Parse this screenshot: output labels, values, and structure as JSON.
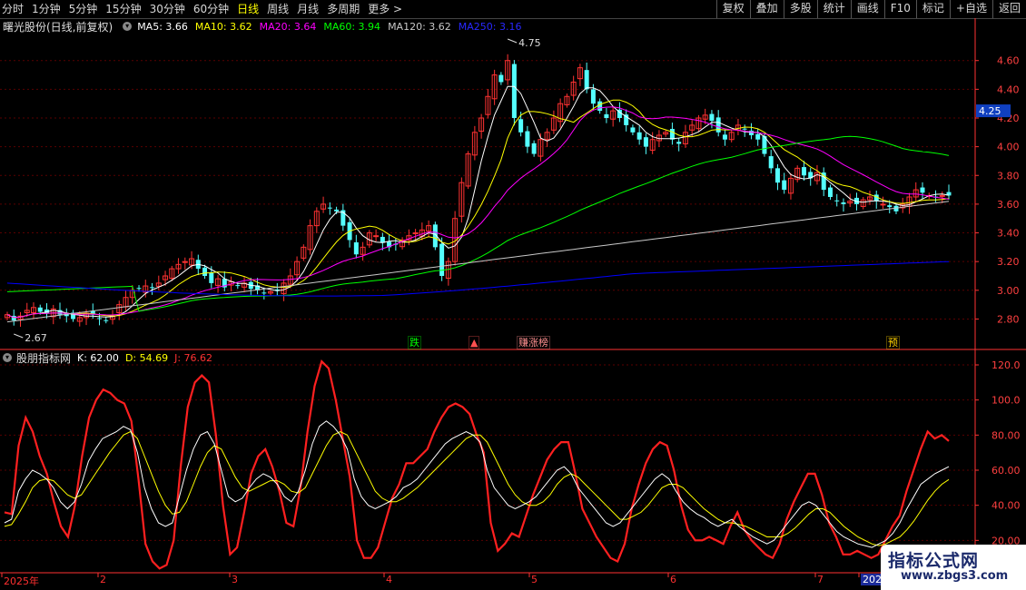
{
  "toolbar": {
    "periods": [
      "分时",
      "1分钟",
      "5分钟",
      "15分钟",
      "30分钟",
      "60分钟",
      "日线",
      "周线",
      "月线",
      "多周期",
      "更多 >"
    ],
    "active_period": "日线",
    "actions": [
      "复权",
      "叠加",
      "多股",
      "统计",
      "画线",
      "F10",
      "标记",
      "+自选",
      "返回"
    ]
  },
  "main_header": {
    "stock": "曙光股份(日线,前复权)",
    "ma5": "MA5: 3.66",
    "ma10": "MA10: 3.62",
    "ma20": "MA20: 3.64",
    "ma60": "MA60: 3.94",
    "ma120": "MA120: 3.62",
    "ma250": "MA250: 3.16"
  },
  "colors": {
    "up": "#ff3232",
    "down": "#54ffff",
    "ma5": "#ffffff",
    "ma10": "#ffff00",
    "ma20": "#ff00ff",
    "ma60": "#00ff00",
    "ma120": "#c8c8c8",
    "ma250": "#0000ff",
    "axis": "#ff3232",
    "grid": "#5a0000"
  },
  "price_axis": {
    "ticks": [
      "4.60",
      "4.40",
      "4.20",
      "4.00",
      "3.80",
      "3.60",
      "3.40",
      "3.20",
      "3.00",
      "2.80"
    ],
    "current": "4.25"
  },
  "annotations": {
    "high": "4.75",
    "low": "2.67"
  },
  "markers": [
    {
      "text": "跌",
      "color": "#00ff00"
    },
    {
      "text": "▲",
      "color": "#ff5050"
    },
    {
      "text": "赚涨榜",
      "color": "#ff9090"
    },
    {
      "text": "预",
      "color": "#ffd000"
    }
  ],
  "indicator_header": {
    "name": "股朋指标网",
    "k": "K: 62.00",
    "d": "D: 54.69",
    "j": "J: 76.62"
  },
  "indicator_axis": {
    "ticks": [
      "120.0",
      "100.0",
      "80.00",
      "60.00",
      "40.00",
      "20.00"
    ]
  },
  "date_axis": {
    "labels": [
      "2025年",
      "2",
      "3",
      "4",
      "5",
      "6",
      "7",
      "2025"
    ]
  },
  "watermark": {
    "line1": "指标公式网",
    "line2": "www.zbgs3.com"
  },
  "chart_data": [
    {
      "type": "candlestick",
      "title": "曙光股份(日线,前复权)",
      "y_range": [
        2.67,
        4.75
      ],
      "last_close": 3.66,
      "series": [
        {
          "name": "MA5",
          "last": 3.66
        },
        {
          "name": "MA10",
          "last": 3.62
        },
        {
          "name": "MA20",
          "last": 3.64
        },
        {
          "name": "MA60",
          "last": 3.94
        },
        {
          "name": "MA120",
          "last": 3.62
        },
        {
          "name": "MA250",
          "last": 3.16
        }
      ],
      "close": [
        2.83,
        2.79,
        2.82,
        2.86,
        2.88,
        2.85,
        2.84,
        2.87,
        2.83,
        2.82,
        2.8,
        2.81,
        2.84,
        2.83,
        2.8,
        2.79,
        2.82,
        2.9,
        2.95,
        3.0,
        3.01,
        3.03,
        3.02,
        3.05,
        3.1,
        3.15,
        3.18,
        3.2,
        3.22,
        3.15,
        3.1,
        3.05,
        3.08,
        3.02,
        3.06,
        3.03,
        3.05,
        3.01,
        3.0,
        2.98,
        2.99,
        3.0,
        3.05,
        3.1,
        3.2,
        3.3,
        3.45,
        3.55,
        3.6,
        3.57,
        3.55,
        3.45,
        3.35,
        3.25,
        3.3,
        3.4,
        3.38,
        3.33,
        3.3,
        3.32,
        3.35,
        3.38,
        3.4,
        3.42,
        3.45,
        3.3,
        3.1,
        3.2,
        3.5,
        3.75,
        3.95,
        4.1,
        4.2,
        4.35,
        4.5,
        4.45,
        4.6,
        4.2,
        4.1,
        4.0,
        3.95,
        4.05,
        4.1,
        4.2,
        4.3,
        4.35,
        4.45,
        4.55,
        4.4,
        4.3,
        4.25,
        4.2,
        4.25,
        4.2,
        4.15,
        4.1,
        4.05,
        4.0,
        4.05,
        4.08,
        4.1,
        4.05,
        4.02,
        4.1,
        4.15,
        4.2,
        4.22,
        4.18,
        4.1,
        4.05,
        4.1,
        4.15,
        4.12,
        4.08,
        4.05,
        3.95,
        3.85,
        3.75,
        3.7,
        3.78,
        3.85,
        3.8,
        3.78,
        3.82,
        3.7,
        3.65,
        3.62,
        3.6,
        3.62,
        3.6,
        3.63,
        3.65,
        3.62,
        3.6,
        3.58,
        3.55,
        3.6,
        3.65,
        3.7,
        3.68,
        3.66,
        3.65,
        3.66,
        3.66
      ],
      "k_end": 62.0,
      "d_end": 54.69,
      "j_end": 76.62
    },
    {
      "type": "line",
      "title": "股朋指标网",
      "y_range": [
        0,
        120
      ],
      "series": [
        {
          "name": "K",
          "values": [
            30,
            32,
            48,
            55,
            60,
            58,
            55,
            50,
            42,
            38,
            42,
            52,
            65,
            72,
            78,
            80,
            82,
            85,
            83,
            70,
            50,
            38,
            30,
            28,
            30,
            45,
            60,
            72,
            80,
            82,
            75,
            60,
            45,
            42,
            44,
            50,
            55,
            58,
            56,
            52,
            45,
            42,
            48,
            60,
            75,
            85,
            88,
            85,
            80,
            72,
            55,
            45,
            40,
            38,
            40,
            42,
            45,
            50,
            52,
            55,
            60,
            65,
            70,
            75,
            78,
            80,
            82,
            80,
            76,
            60,
            50,
            45,
            40,
            38,
            40,
            42,
            45,
            50,
            55,
            60,
            62,
            58,
            50,
            45,
            40,
            35,
            30,
            28,
            30,
            35,
            40,
            45,
            50,
            55,
            58,
            55,
            48,
            42,
            38,
            35,
            33,
            30,
            28,
            30,
            32,
            28,
            25,
            22,
            20,
            18,
            20,
            25,
            30,
            35,
            40,
            42,
            40,
            35,
            30,
            25,
            22,
            20,
            18,
            17,
            16,
            18,
            20,
            24,
            30,
            38,
            45,
            52,
            55,
            58,
            60,
            62
          ]
        },
        {
          "name": "D",
          "values": [
            28,
            29,
            35,
            42,
            50,
            54,
            55,
            54,
            50,
            46,
            44,
            46,
            52,
            58,
            64,
            70,
            75,
            80,
            82,
            78,
            68,
            58,
            48,
            40,
            35,
            36,
            42,
            52,
            62,
            70,
            74,
            72,
            64,
            56,
            50,
            48,
            50,
            52,
            54,
            54,
            52,
            48,
            47,
            50,
            58,
            66,
            74,
            80,
            82,
            80,
            72,
            64,
            56,
            48,
            44,
            42,
            42,
            44,
            47,
            50,
            54,
            58,
            62,
            66,
            70,
            74,
            78,
            80,
            80,
            76,
            68,
            60,
            52,
            46,
            42,
            40,
            40,
            42,
            46,
            52,
            56,
            58,
            56,
            52,
            48,
            44,
            40,
            36,
            32,
            32,
            34,
            36,
            40,
            45,
            50,
            52,
            52,
            50,
            46,
            42,
            38,
            35,
            32,
            30,
            30,
            29,
            28,
            26,
            24,
            22,
            22,
            22,
            24,
            27,
            31,
            35,
            38,
            38,
            36,
            32,
            28,
            25,
            22,
            20,
            18,
            17,
            18,
            20,
            22,
            26,
            31,
            37,
            43,
            48,
            52,
            54.69
          ]
        },
        {
          "name": "J",
          "values": [
            36,
            35,
            74,
            90,
            82,
            68,
            58,
            42,
            28,
            22,
            40,
            68,
            90,
            100,
            106,
            104,
            100,
            98,
            88,
            55,
            18,
            8,
            4,
            6,
            20,
            62,
            96,
            110,
            114,
            110,
            80,
            40,
            12,
            16,
            36,
            58,
            68,
            72,
            62,
            48,
            30,
            28,
            50,
            82,
            108,
            122,
            118,
            100,
            78,
            56,
            20,
            10,
            10,
            16,
            30,
            44,
            52,
            64,
            64,
            68,
            72,
            82,
            90,
            96,
            98,
            96,
            92,
            80,
            70,
            30,
            14,
            18,
            24,
            22,
            34,
            46,
            56,
            66,
            72,
            76,
            76,
            58,
            38,
            30,
            22,
            16,
            10,
            8,
            18,
            38,
            52,
            64,
            72,
            76,
            74,
            60,
            40,
            26,
            20,
            20,
            22,
            20,
            18,
            28,
            36,
            26,
            20,
            16,
            12,
            10,
            18,
            32,
            42,
            50,
            58,
            58,
            46,
            30,
            22,
            12,
            12,
            14,
            12,
            10,
            12,
            20,
            28,
            34,
            48,
            60,
            72,
            82,
            78,
            80,
            76.62
          ]
        }
      ]
    }
  ]
}
